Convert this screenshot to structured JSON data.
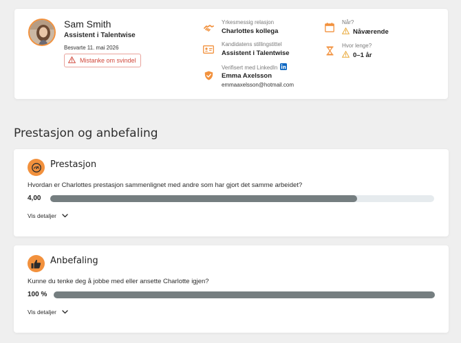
{
  "referee": {
    "name": "Sam Smith",
    "role": "Assistent i Talentwise",
    "answered": "Besvarte 11. mai 2026",
    "fraud_button": "Mistanke om svindel"
  },
  "info": {
    "relation_label": "Yrkesmessig relasjon",
    "relation_value": "Charlottes kollega",
    "job_title_label": "Kandidatens stillingstittel",
    "job_title_value": "Assistent i Talentwise",
    "verified_label": "Verifisert med LinkedIn",
    "verified_name": "Emma Axelsson",
    "verified_email": "emmaaxelsson@hotmail.com",
    "when_label": "Når?",
    "when_value": "Nåværende",
    "duration_label": "Hvor lenge?",
    "duration_value": "0–1 år"
  },
  "section_title": "Prestasjon og anbefaling",
  "performance": {
    "title": "Prestasjon",
    "question": "Hvordan er Charlottes prestasjon sammenlignet med andre som har gjort det samme arbeidet?",
    "value_text": "4,00",
    "fill": 0.8,
    "details": "Vis detaljer"
  },
  "recommendation": {
    "title": "Anbefaling",
    "question": "Kunne du tenke deg å jobbe med eller ansette Charlotte igjen?",
    "value_text": "100 %",
    "fill": 1.0,
    "details": "Vis detaljer"
  },
  "colors": {
    "accent": "#f2913d",
    "bar_fill": "#757e80",
    "bar_track": "#e6ebee",
    "warning": "#e8a530",
    "danger": "#d0473a",
    "linkedin": "#0a66c2"
  }
}
